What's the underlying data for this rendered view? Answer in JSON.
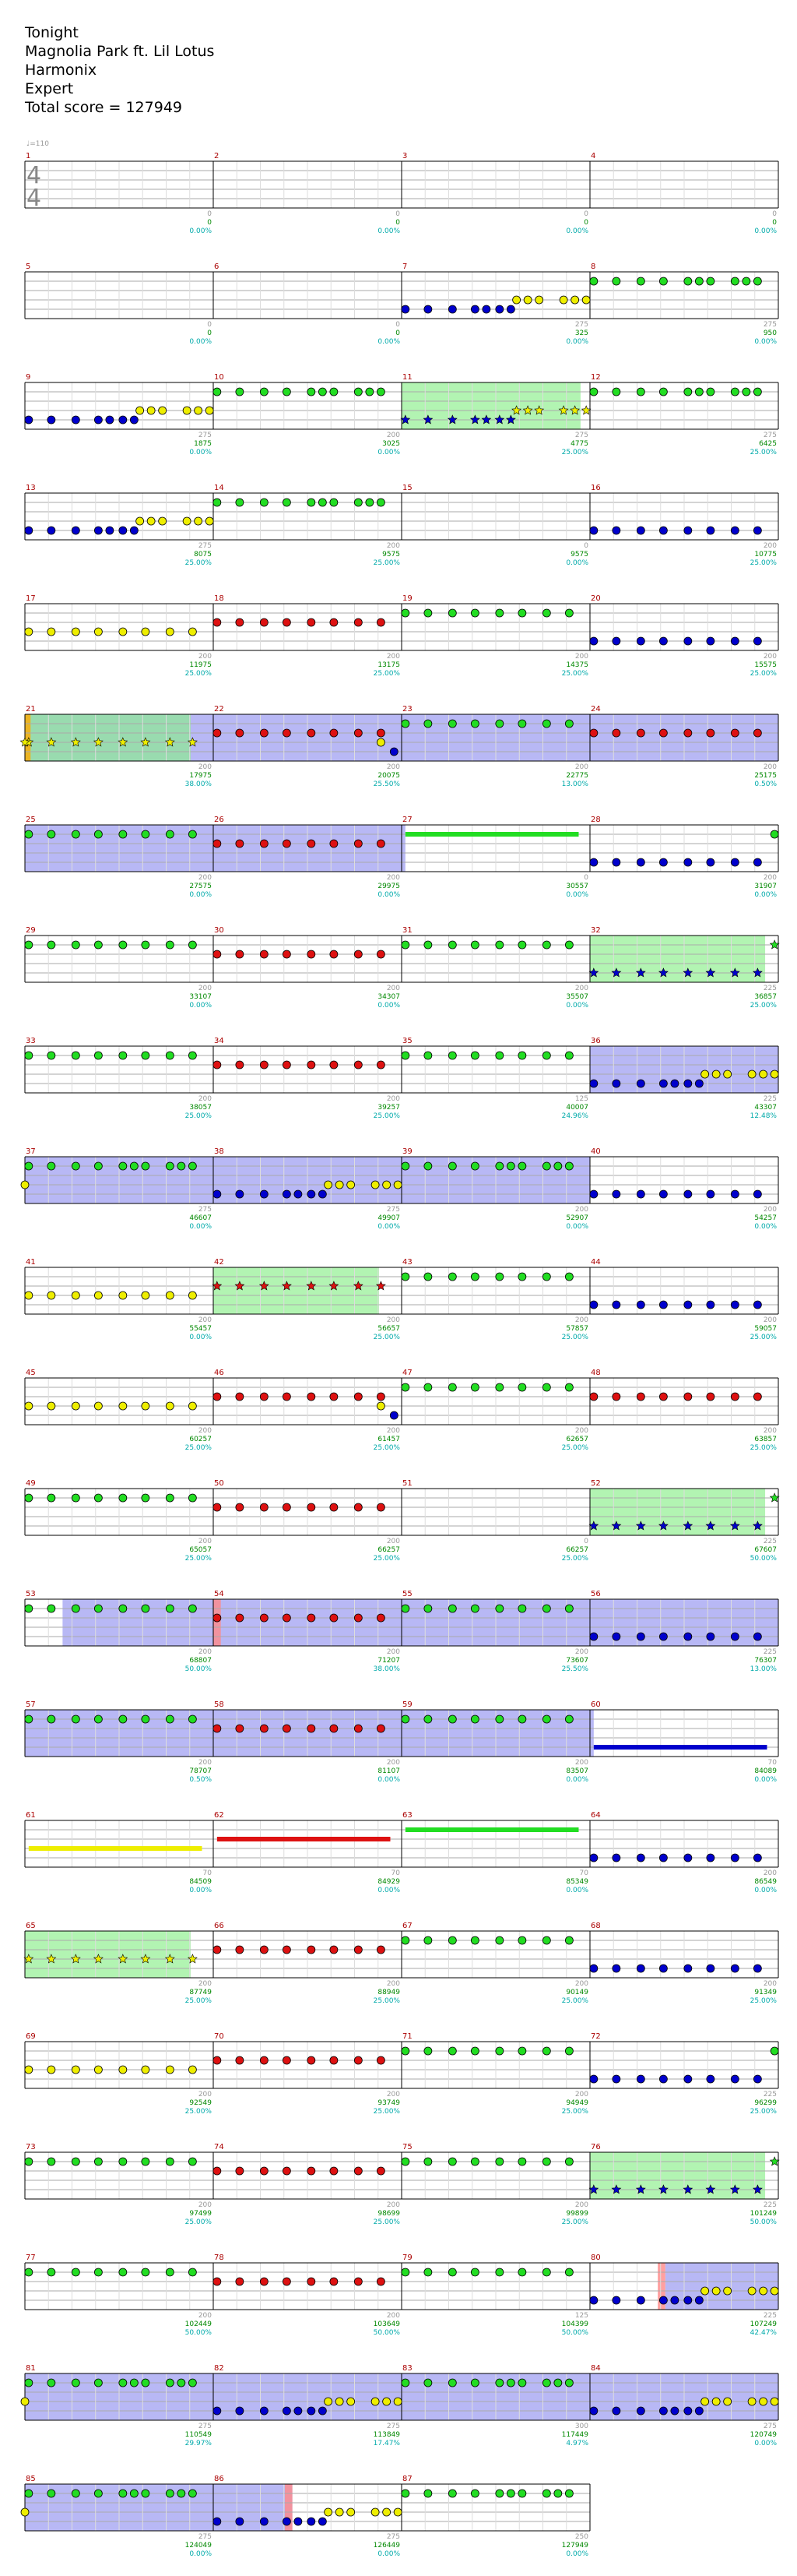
{
  "song": {
    "title": "Tonight",
    "artist": "Magnolia Park ft. Lil Lotus",
    "charter": "Harmonix",
    "difficulty": "Expert",
    "total_score_label": "Total score = 127949"
  },
  "tempo_label": "♩=110",
  "time_signature": {
    "top": "4",
    "bottom": "4"
  },
  "colors": {
    "green": "#22dd22",
    "red": "#dd1111",
    "yellow": "#eeee00",
    "blue": "#0000cc",
    "orange": "#ffaa00",
    "overdrive": "#88ee88",
    "solo": "#8888ee",
    "measure_number": "#aa0000",
    "score_text": "#008800",
    "percent_text": "#00aaaa",
    "grid": "#aaaaaa"
  },
  "measures": [
    {
      "n": "1",
      "base": "0",
      "score": "0",
      "pct": "0.00%"
    },
    {
      "n": "2",
      "base": "0",
      "score": "0",
      "pct": "0.00%"
    },
    {
      "n": "3",
      "base": "0",
      "score": "0",
      "pct": "0.00%"
    },
    {
      "n": "4",
      "base": "0",
      "score": "0",
      "pct": "0.00%"
    },
    {
      "n": "5",
      "base": "0",
      "score": "0",
      "pct": "0.00%"
    },
    {
      "n": "6",
      "base": "0",
      "score": "0",
      "pct": "0.00%"
    },
    {
      "n": "7",
      "base": "275",
      "score": "325",
      "pct": "0.00%"
    },
    {
      "n": "8",
      "base": "275",
      "score": "950",
      "pct": "0.00%"
    },
    {
      "n": "9",
      "base": "275",
      "score": "1875",
      "pct": "0.00%"
    },
    {
      "n": "10",
      "base": "200",
      "score": "3025",
      "pct": "0.00%"
    },
    {
      "n": "11",
      "base": "275",
      "score": "4775",
      "pct": "25.00%"
    },
    {
      "n": "12",
      "base": "275",
      "score": "6425",
      "pct": "25.00%"
    },
    {
      "n": "13",
      "base": "275",
      "score": "8075",
      "pct": "25.00%"
    },
    {
      "n": "14",
      "base": "200",
      "score": "9575",
      "pct": "25.00%"
    },
    {
      "n": "15",
      "base": "0",
      "score": "9575",
      "pct": "0.00%"
    },
    {
      "n": "16",
      "base": "200",
      "score": "10775",
      "pct": "25.00%"
    },
    {
      "n": "17",
      "base": "200",
      "score": "11975",
      "pct": "25.00%"
    },
    {
      "n": "18",
      "base": "200",
      "score": "13175",
      "pct": "25.00%"
    },
    {
      "n": "19",
      "base": "200",
      "score": "14375",
      "pct": "25.00%"
    },
    {
      "n": "20",
      "base": "200",
      "score": "15575",
      "pct": "25.00%"
    },
    {
      "n": "21",
      "base": "200",
      "score": "17975",
      "pct": "38.00%"
    },
    {
      "n": "22",
      "base": "200",
      "score": "20075",
      "pct": "25.50%"
    },
    {
      "n": "23",
      "base": "200",
      "score": "22775",
      "pct": "13.00%"
    },
    {
      "n": "24",
      "base": "200",
      "score": "25175",
      "pct": "0.50%"
    },
    {
      "n": "25",
      "base": "200",
      "score": "27575",
      "pct": "0.00%"
    },
    {
      "n": "26",
      "base": "200",
      "score": "29975",
      "pct": "0.00%"
    },
    {
      "n": "27",
      "base": "0",
      "score": "30557",
      "pct": "0.00%"
    },
    {
      "n": "28",
      "base": "200",
      "score": "31907",
      "pct": "0.00%"
    },
    {
      "n": "29",
      "base": "200",
      "score": "33107",
      "pct": "0.00%"
    },
    {
      "n": "30",
      "base": "200",
      "score": "34307",
      "pct": "0.00%"
    },
    {
      "n": "31",
      "base": "200",
      "score": "35507",
      "pct": "0.00%"
    },
    {
      "n": "32",
      "base": "225",
      "score": "36857",
      "pct": "25.00%"
    },
    {
      "n": "33",
      "base": "200",
      "score": "38057",
      "pct": "25.00%"
    },
    {
      "n": "34",
      "base": "200",
      "score": "39257",
      "pct": "25.00%"
    },
    {
      "n": "35",
      "base": "125",
      "score": "40007",
      "pct": "24.96%"
    },
    {
      "n": "36",
      "base": "225",
      "score": "43307",
      "pct": "12.48%"
    },
    {
      "n": "37",
      "base": "275",
      "score": "46607",
      "pct": "0.00%"
    },
    {
      "n": "38",
      "base": "275",
      "score": "49907",
      "pct": "0.00%"
    },
    {
      "n": "39",
      "base": "200",
      "score": "52907",
      "pct": "0.00%"
    },
    {
      "n": "40",
      "base": "200",
      "score": "54257",
      "pct": "0.00%"
    },
    {
      "n": "41",
      "base": "200",
      "score": "55457",
      "pct": "0.00%"
    },
    {
      "n": "42",
      "base": "200",
      "score": "56657",
      "pct": "25.00%"
    },
    {
      "n": "43",
      "base": "200",
      "score": "57857",
      "pct": "25.00%"
    },
    {
      "n": "44",
      "base": "200",
      "score": "59057",
      "pct": "25.00%"
    },
    {
      "n": "45",
      "base": "200",
      "score": "60257",
      "pct": "25.00%"
    },
    {
      "n": "46",
      "base": "200",
      "score": "61457",
      "pct": "25.00%"
    },
    {
      "n": "47",
      "base": "200",
      "score": "62657",
      "pct": "25.00%"
    },
    {
      "n": "48",
      "base": "200",
      "score": "63857",
      "pct": "25.00%"
    },
    {
      "n": "49",
      "base": "200",
      "score": "65057",
      "pct": "25.00%"
    },
    {
      "n": "50",
      "base": "200",
      "score": "66257",
      "pct": "25.00%"
    },
    {
      "n": "51",
      "base": "0",
      "score": "66257",
      "pct": "25.00%"
    },
    {
      "n": "52",
      "base": "225",
      "score": "67607",
      "pct": "50.00%"
    },
    {
      "n": "53",
      "base": "200",
      "score": "68807",
      "pct": "50.00%"
    },
    {
      "n": "54",
      "base": "200",
      "score": "71207",
      "pct": "38.00%"
    },
    {
      "n": "55",
      "base": "200",
      "score": "73607",
      "pct": "25.50%"
    },
    {
      "n": "56",
      "base": "225",
      "score": "76307",
      "pct": "13.00%"
    },
    {
      "n": "57",
      "base": "200",
      "score": "78707",
      "pct": "0.50%"
    },
    {
      "n": "58",
      "base": "200",
      "score": "81107",
      "pct": "0.00%"
    },
    {
      "n": "59",
      "base": "200",
      "score": "83507",
      "pct": "0.00%"
    },
    {
      "n": "60",
      "base": "70",
      "score": "84089",
      "pct": "0.00%"
    },
    {
      "n": "61",
      "base": "70",
      "score": "84509",
      "pct": "0.00%"
    },
    {
      "n": "62",
      "base": "70",
      "score": "84929",
      "pct": "0.00%"
    },
    {
      "n": "63",
      "base": "70",
      "score": "85349",
      "pct": "0.00%"
    },
    {
      "n": "64",
      "base": "200",
      "score": "86549",
      "pct": "0.00%"
    },
    {
      "n": "65",
      "base": "200",
      "score": "87749",
      "pct": "25.00%"
    },
    {
      "n": "66",
      "base": "200",
      "score": "88949",
      "pct": "25.00%"
    },
    {
      "n": "67",
      "base": "200",
      "score": "90149",
      "pct": "25.00%"
    },
    {
      "n": "68",
      "base": "200",
      "score": "91349",
      "pct": "25.00%"
    },
    {
      "n": "69",
      "base": "200",
      "score": "92549",
      "pct": "25.00%"
    },
    {
      "n": "70",
      "base": "200",
      "score": "93749",
      "pct": "25.00%"
    },
    {
      "n": "71",
      "base": "200",
      "score": "94949",
      "pct": "25.00%"
    },
    {
      "n": "72",
      "base": "225",
      "score": "96299",
      "pct": "25.00%"
    },
    {
      "n": "73",
      "base": "200",
      "score": "97499",
      "pct": "25.00%"
    },
    {
      "n": "74",
      "base": "200",
      "score": "98699",
      "pct": "25.00%"
    },
    {
      "n": "75",
      "base": "200",
      "score": "99899",
      "pct": "25.00%"
    },
    {
      "n": "76",
      "base": "225",
      "score": "101249",
      "pct": "50.00%"
    },
    {
      "n": "77",
      "base": "200",
      "score": "102449",
      "pct": "50.00%"
    },
    {
      "n": "78",
      "base": "200",
      "score": "103649",
      "pct": "50.00%"
    },
    {
      "n": "79",
      "base": "125",
      "score": "104399",
      "pct": "50.00%"
    },
    {
      "n": "80",
      "base": "225",
      "score": "107249",
      "pct": "42.47%"
    },
    {
      "n": "81",
      "base": "275",
      "score": "110549",
      "pct": "29.97%"
    },
    {
      "n": "82",
      "base": "275",
      "score": "113849",
      "pct": "17.47%"
    },
    {
      "n": "83",
      "base": "300",
      "score": "117449",
      "pct": "4.97%"
    },
    {
      "n": "84",
      "base": "275",
      "score": "120749",
      "pct": "0.00%"
    },
    {
      "n": "85",
      "base": "275",
      "score": "124049",
      "pct": "0.00%"
    },
    {
      "n": "86",
      "base": "275",
      "score": "126449",
      "pct": "0.00%"
    },
    {
      "n": "87",
      "base": "250",
      "score": "127949",
      "pct": "0.00%"
    }
  ]
}
